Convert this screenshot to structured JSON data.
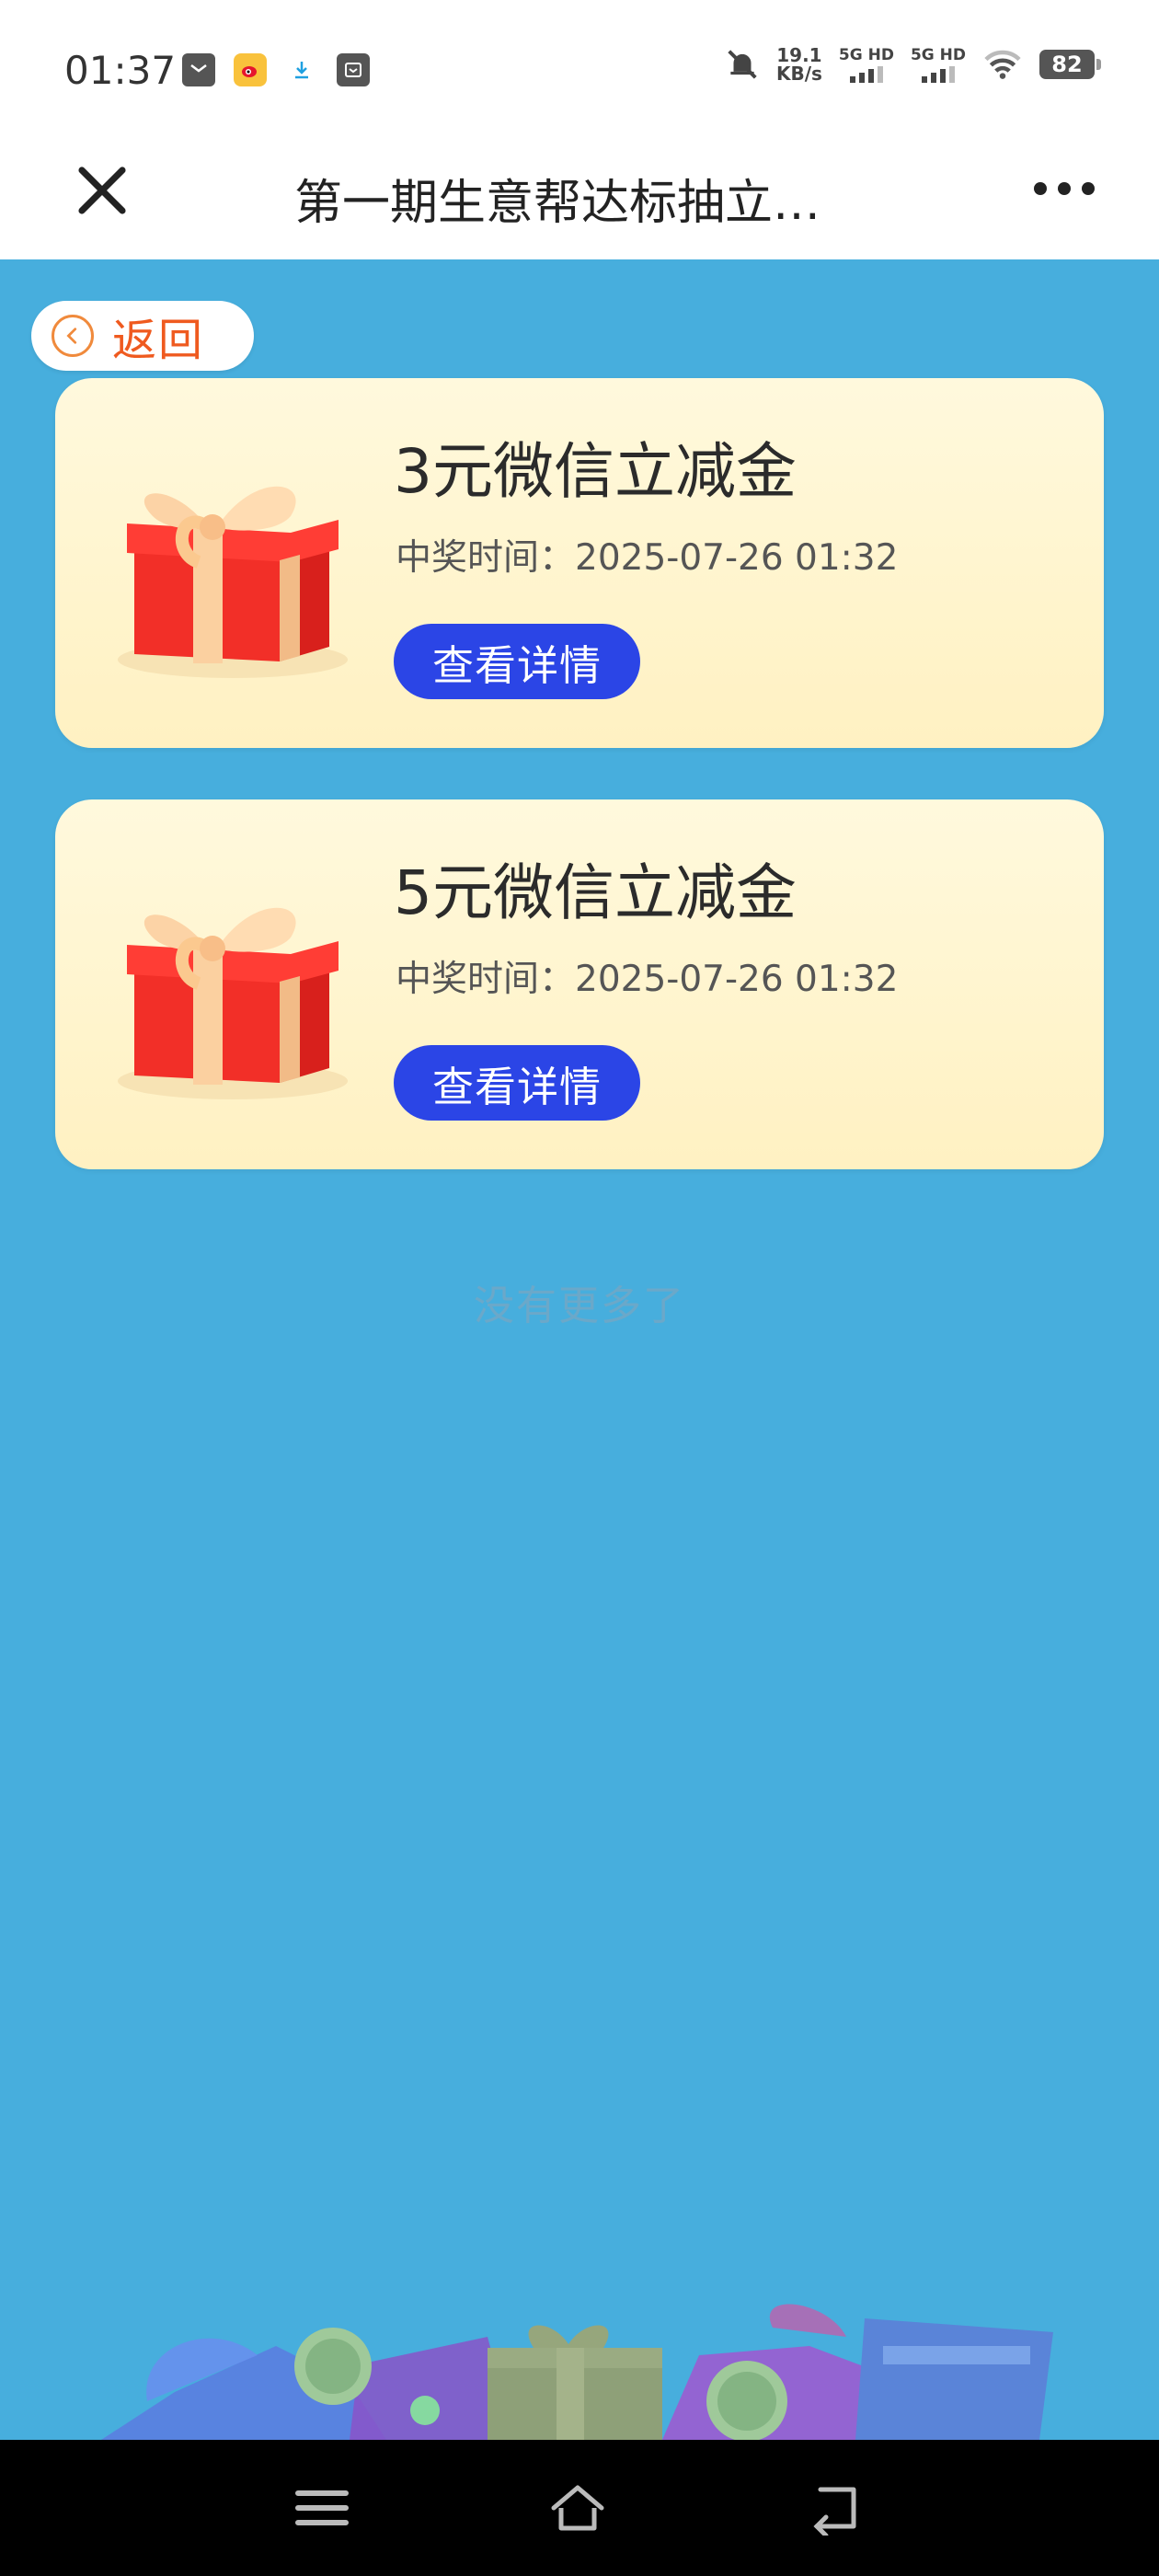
{
  "status_bar": {
    "time": "01:37",
    "net_speed_value": "19.1",
    "net_speed_unit": "KB/s",
    "sim1": "5G HD",
    "sim2": "5G HD",
    "battery": "82"
  },
  "nav": {
    "title": "第一期生意帮达标抽立…"
  },
  "back_button": {
    "label": "返回"
  },
  "prizes": [
    {
      "title": "3元微信立减金",
      "time": "中奖时间：2025-07-26 01:32",
      "button": "查看详情"
    },
    {
      "title": "5元微信立减金",
      "time": "中奖时间：2025-07-26 01:32",
      "button": "查看详情"
    }
  ],
  "footer_text": "没有更多了",
  "colors": {
    "background": "#47aedd",
    "button": "#2b45e6",
    "back_text": "#ef5a1f",
    "card_top": "#fff9dd",
    "card_bottom": "#fff1c2"
  },
  "icons": [
    "close-icon",
    "more-icon",
    "back-arrow-icon",
    "gift-icon",
    "menu-icon",
    "home-icon",
    "back-icon"
  ]
}
